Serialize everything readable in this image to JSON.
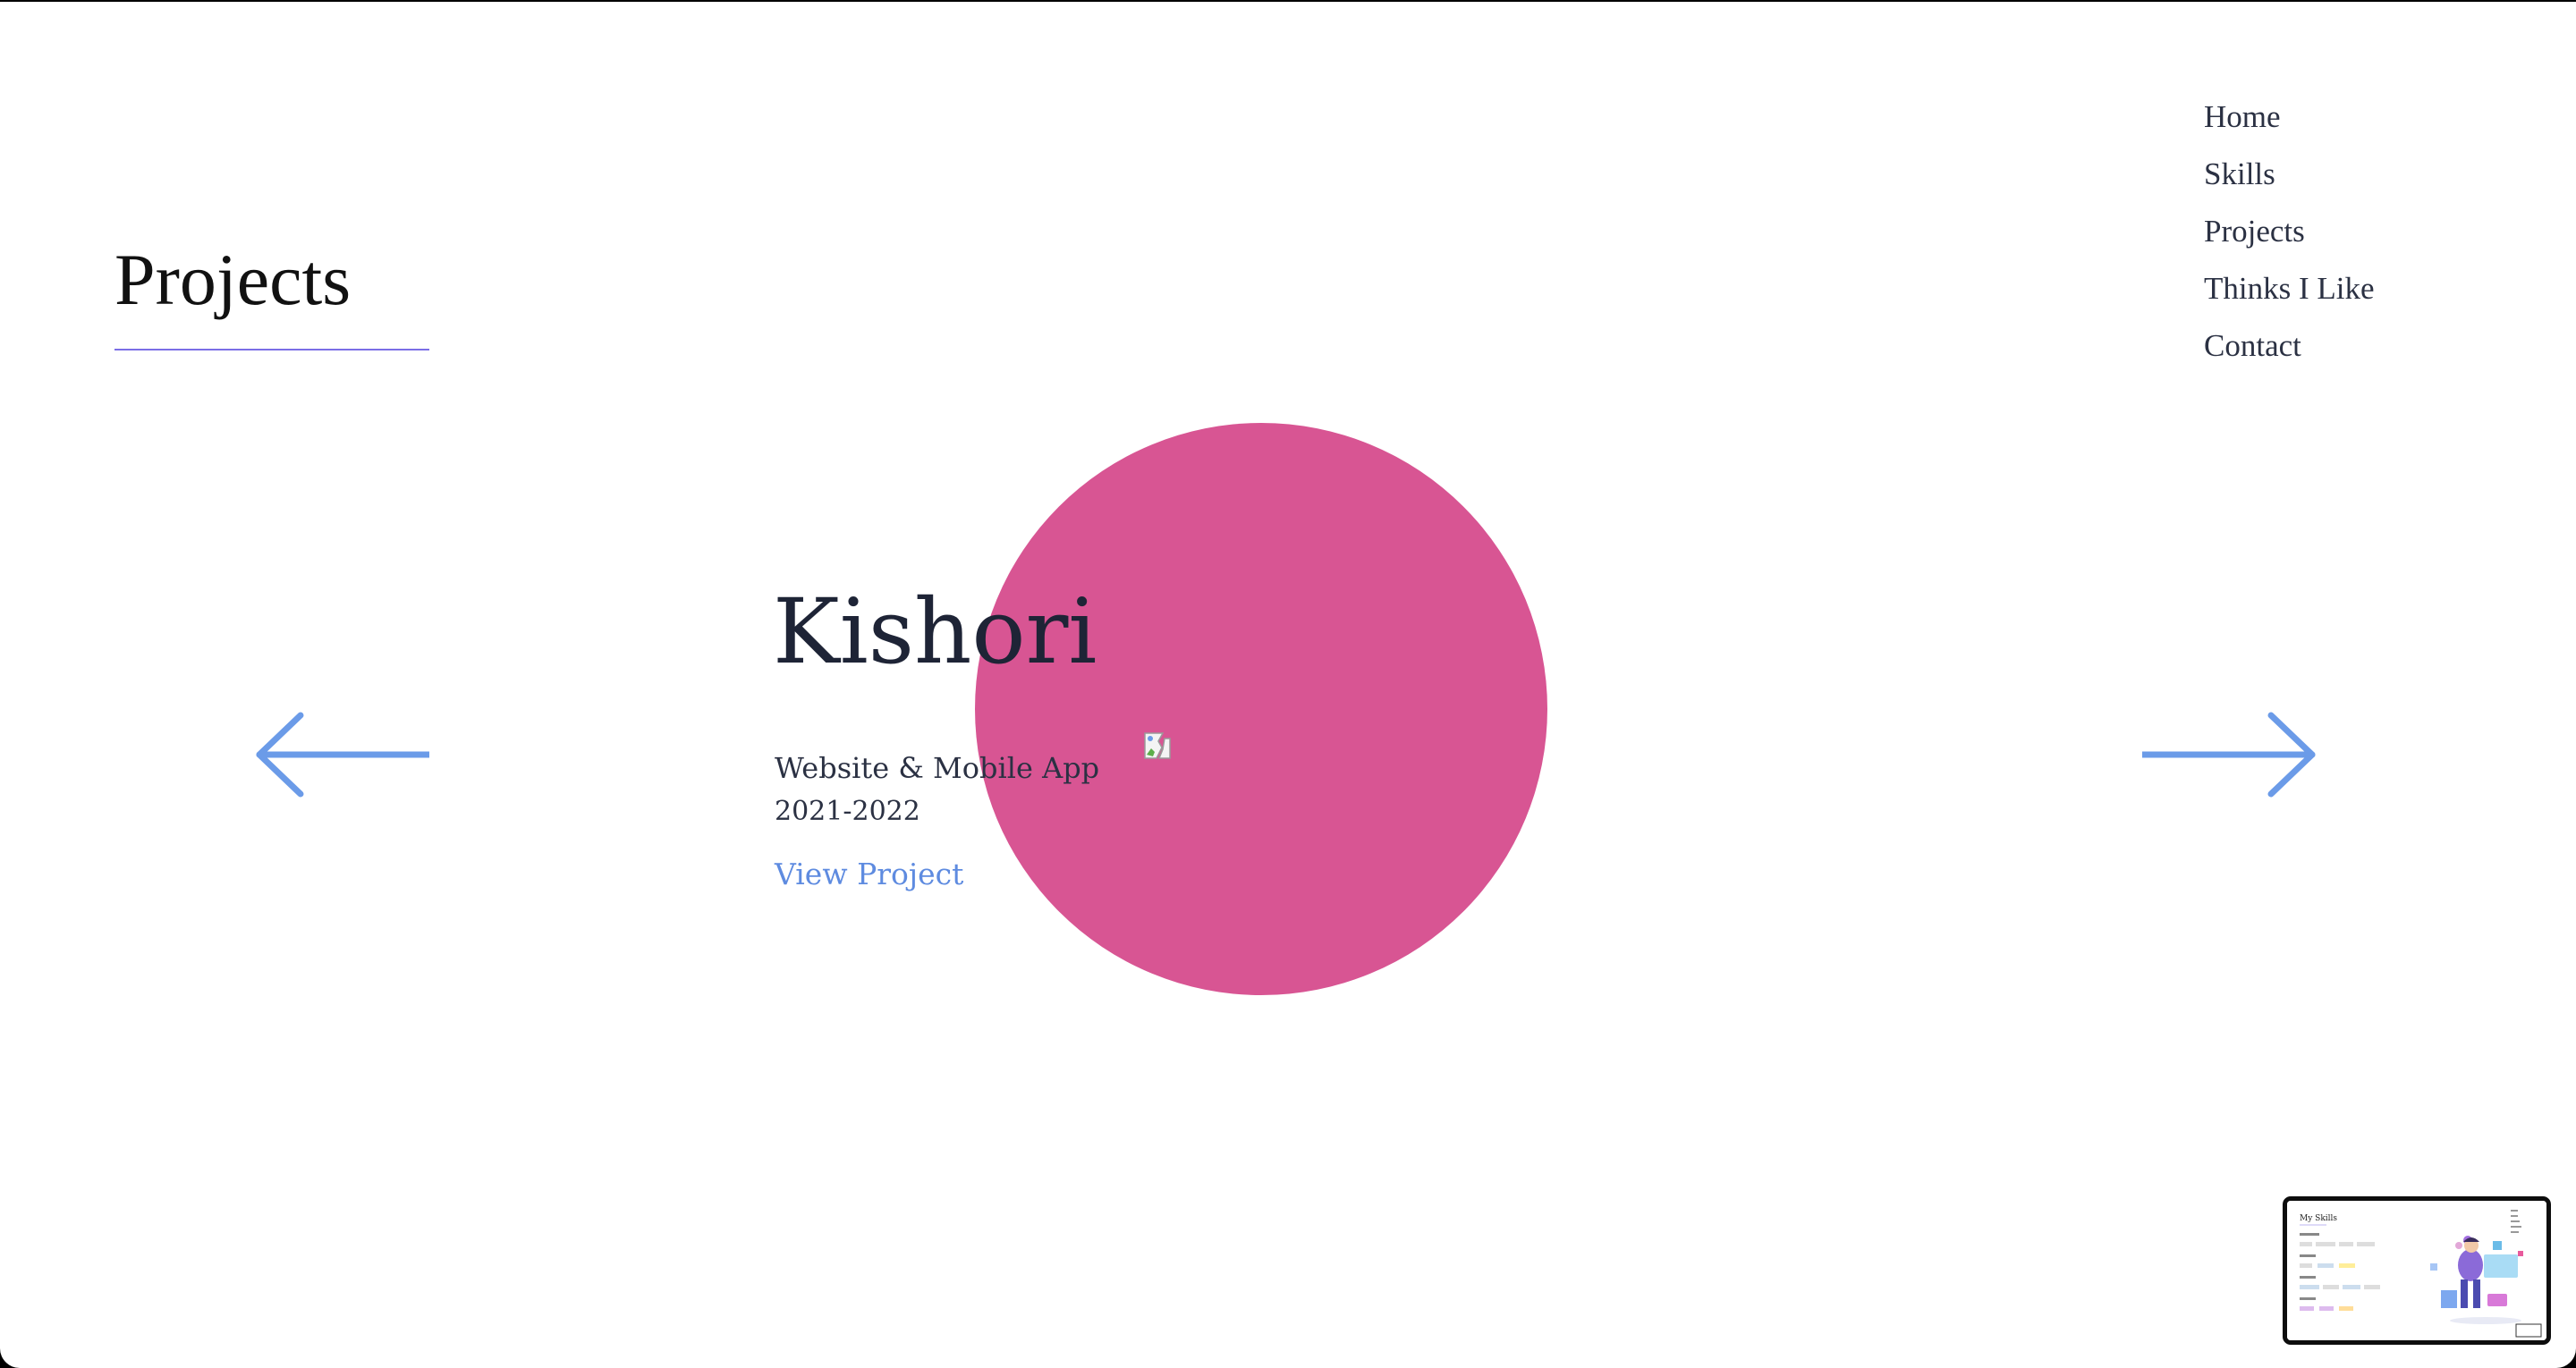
{
  "section": {
    "title": "Projects"
  },
  "nav": {
    "items": [
      {
        "label": "Home"
      },
      {
        "label": "Skills"
      },
      {
        "label": "Projects"
      },
      {
        "label": "Thinks I Like"
      },
      {
        "label": "Contact"
      }
    ]
  },
  "project": {
    "name": "Kishori",
    "type": "Website & Mobile App",
    "years": "2021-2022",
    "link_label": "View Project",
    "circle_color": "#d85593"
  },
  "colors": {
    "accent_underline": "#7b6ee6",
    "arrow": "#6b9be8",
    "link": "#5e8be0",
    "text": "#1e2436"
  },
  "icons": {
    "prev": "arrow-left-icon",
    "next": "arrow-right-icon",
    "broken_image": "broken-image-icon"
  },
  "thumbnail": {
    "title": "My Skills"
  }
}
